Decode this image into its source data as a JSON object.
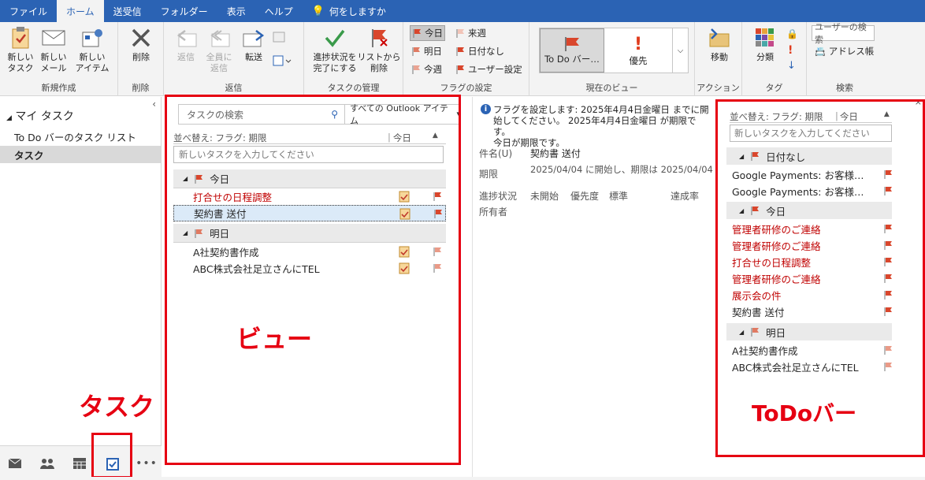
{
  "tabs": [
    "ファイル",
    "ホーム",
    "送受信",
    "フォルダー",
    "表示",
    "ヘルプ"
  ],
  "tell_me": "何をしますか",
  "ribbon": {
    "new_task": "新しい\nタスク",
    "new_mail": "新しい\nメール",
    "new_items": "新しい\nアイテム",
    "group_new": "新規作成",
    "delete": "削除",
    "group_delete": "削除",
    "reply": "返信",
    "reply_all": "全員に\n返信",
    "forward": "転送",
    "group_respond": "返信",
    "mark_complete": "進捗状況を\n完了にする",
    "remove_list": "リストから\n削除",
    "group_manage": "タスクの管理",
    "flag_today": "今日",
    "flag_tomorrow": "明日",
    "flag_thisweek": "今週",
    "flag_nextweek": "来週",
    "flag_nodate": "日付なし",
    "flag_custom": "ユーザー設定",
    "group_flags": "フラグの設定",
    "view_todo": "To Do バー…",
    "view_priority": "優先",
    "group_view": "現在のビュー",
    "move": "移動",
    "group_actions": "アクション",
    "categorize": "分類",
    "group_tags": "タグ",
    "search_people": "ユーザーの検索",
    "address_book": "アドレス帳",
    "group_find": "検索"
  },
  "nav": {
    "heading": "マイ タスク",
    "items": [
      "To Do バーのタスク リスト",
      "タスク"
    ]
  },
  "view": {
    "search_placeholder": "タスクの検索",
    "scope": "すべての Outlook アイテム",
    "sort_label": "並べ替え: フラグ: 期限",
    "sort_value": "今日",
    "new_task_placeholder": "新しいタスクを入力してください",
    "groups": [
      {
        "label": "今日",
        "tasks": [
          {
            "title": "打合せの日程調整",
            "overdue": true
          },
          {
            "title": "契約書 送付",
            "overdue": false,
            "selected": true
          }
        ]
      },
      {
        "label": "明日",
        "tasks": [
          {
            "title": "A社契約書作成",
            "overdue": false
          },
          {
            "title": "ABC株式会社足立さんにTEL",
            "overdue": false
          }
        ]
      }
    ]
  },
  "reading": {
    "info": "フラグを設定します: 2025年4月4日金曜日 までに開始してください。 2025年4月4日金曜日 が期限です。\n今日が期限です。",
    "subject_label": "件名(U)",
    "subject": "契約書 送付",
    "due_label": "期限",
    "due": "2025/04/04 に開始し、期限は 2025/04/04",
    "status_label": "進捗状況",
    "status": "未開始",
    "priority_label": "優先度",
    "priority": "標準",
    "percent_label": "達成率",
    "owner_label": "所有者"
  },
  "todo": {
    "sort_label": "並べ替え: フラグ: 期限",
    "sort_value": "今日",
    "new_task_placeholder": "新しいタスクを入力してください",
    "groups": [
      {
        "label": "日付なし",
        "tasks": [
          {
            "title": "Google Payments: お客様…",
            "overdue": false
          },
          {
            "title": "Google Payments: お客様…",
            "overdue": false
          }
        ]
      },
      {
        "label": "今日",
        "tasks": [
          {
            "title": "管理者研修のご連絡",
            "overdue": true
          },
          {
            "title": "管理者研修のご連絡",
            "overdue": true
          },
          {
            "title": "打合せの日程調整",
            "overdue": true
          },
          {
            "title": "管理者研修のご連絡",
            "overdue": true
          },
          {
            "title": "展示会の件",
            "overdue": true
          },
          {
            "title": "契約書 送付",
            "overdue": false
          }
        ]
      },
      {
        "label": "明日",
        "tasks": [
          {
            "title": "A社契約書作成",
            "overdue": false
          },
          {
            "title": "ABC株式会社足立さんにTEL",
            "overdue": false
          }
        ]
      }
    ]
  },
  "annotations": {
    "view": "ビュー",
    "tasks": "タスク",
    "todo": "ToDoバー"
  },
  "colors": {
    "accent": "#2b63b4",
    "flag": "#d9462c",
    "overdue": "#c00000",
    "annotation": "#e60012"
  }
}
